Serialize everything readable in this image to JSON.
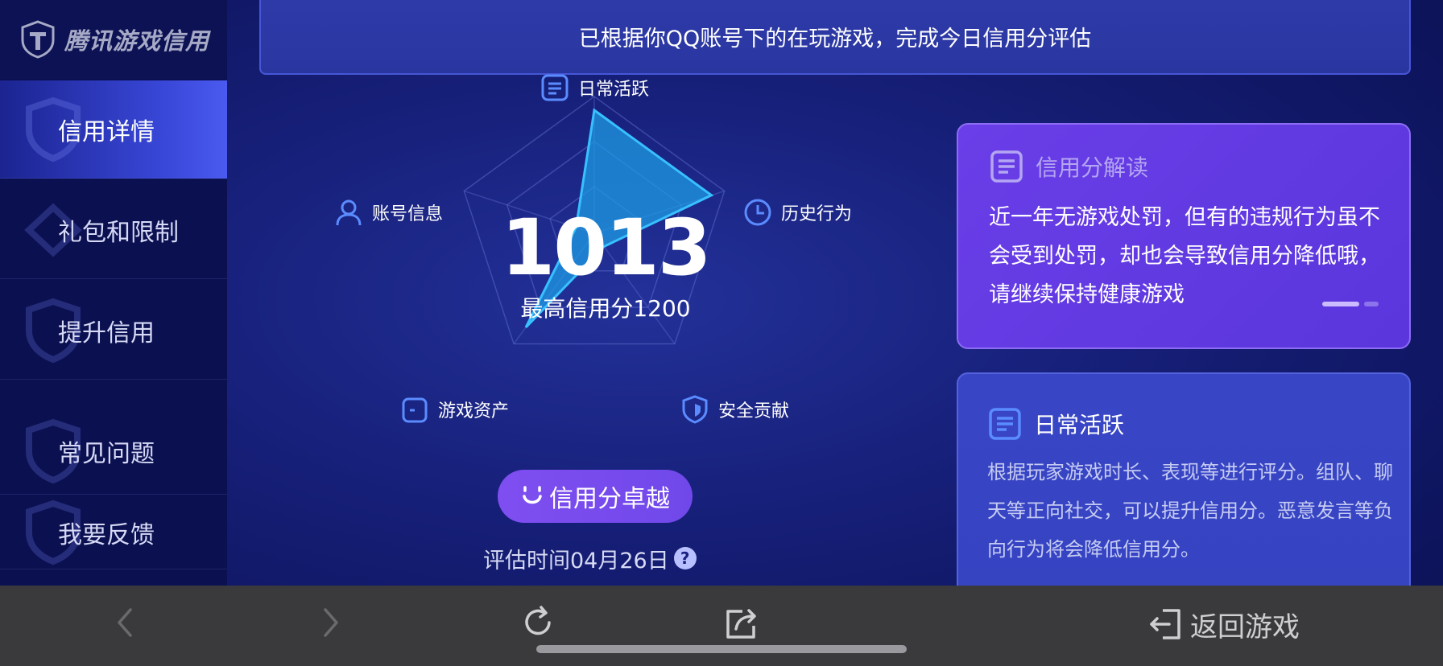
{
  "app": {
    "logo_text": "腾讯游戏信用"
  },
  "sidebar": {
    "items": [
      {
        "label": "信用详情",
        "active": true
      },
      {
        "label": "礼包和限制",
        "active": false
      },
      {
        "label": "提升信用",
        "active": false
      },
      {
        "label": "常见问题",
        "active": false
      },
      {
        "label": "我要反馈",
        "active": false
      }
    ]
  },
  "banner": {
    "text": "已根据你QQ账号下的在玩游戏，完成今日信用分评估"
  },
  "score": {
    "value": "1013",
    "max_text": "最高信用分1200",
    "grade_label": "信用分卓越",
    "eval_time": "评估时间04月26日",
    "help_icon": "?"
  },
  "radar": {
    "dimensions": [
      {
        "label": "日常活跃",
        "icon": "document-icon",
        "value": 0.9
      },
      {
        "label": "历史行为",
        "icon": "clock-icon",
        "value": 0.9
      },
      {
        "label": "安全贡献",
        "icon": "shield-icon",
        "value": 0.12
      },
      {
        "label": "游戏资产",
        "icon": "wallet-icon",
        "value": 0.85
      },
      {
        "label": "账号信息",
        "icon": "user-icon",
        "value": 0.14
      }
    ]
  },
  "cards": {
    "interpretation": {
      "title": "信用分解读",
      "body": "近一年无游戏处罚，但有的违规行为虽不会受到处罚，却也会导致信用分降低哦，请继续保持健康游戏"
    },
    "daily": {
      "title": "日常活跃",
      "body": "根据玩家游戏时长、表现等进行评分。组队、聊天等正向社交，可以提升信用分。恶意发言等负向行为将会降低信用分。"
    }
  },
  "bottombar": {
    "return_label": "返回游戏"
  },
  "colors": {
    "accent_purple": "#7048ea",
    "radar_fill": "#1d9fe8",
    "background": "#17207a"
  }
}
